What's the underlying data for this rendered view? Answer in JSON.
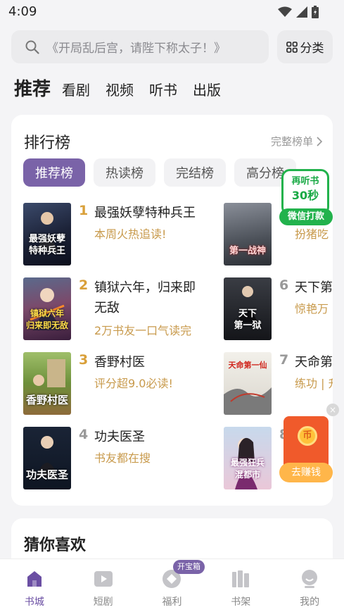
{
  "status": {
    "time": "4:09",
    "icons": [
      "wifi-icon",
      "signal-icon",
      "battery-icon"
    ]
  },
  "search": {
    "placeholder": "《开局乱后宫，请陛下称太子！》",
    "category_label": "分类"
  },
  "top_tabs": [
    {
      "label": "推荐",
      "active": true
    },
    {
      "label": "看剧"
    },
    {
      "label": "视频"
    },
    {
      "label": "听书"
    },
    {
      "label": "出版"
    }
  ],
  "ranking": {
    "title": "排行榜",
    "more_label": "完整榜单",
    "chips": [
      {
        "label": "推荐榜",
        "active": true
      },
      {
        "label": "热读榜"
      },
      {
        "label": "完结榜"
      },
      {
        "label": "高分榜"
      }
    ],
    "left_books": [
      {
        "rank": "1",
        "title": "最强妖孽特种兵王",
        "subtitle": "本周火热追读!",
        "cover_text": "最强妖孽\n特种兵王"
      },
      {
        "rank": "2",
        "title": "镇狱六年，归来即无敌",
        "subtitle": "2万书友一口气读完",
        "cover_text": "镇狱六年\n归来即无敌"
      },
      {
        "rank": "3",
        "title": "香野村医",
        "subtitle": "评分超9.0必读!",
        "cover_text": "香野村医"
      },
      {
        "rank": "4",
        "title": "功夫医圣",
        "subtitle": "书友都在搜",
        "cover_text": "功夫医圣"
      }
    ],
    "right_books": [
      {
        "rank": "",
        "title": "",
        "subtitle": "扮猪吃",
        "cover_text": "第一战神"
      },
      {
        "rank": "6",
        "title": "天下第",
        "subtitle": "惊艳万",
        "cover_text": "天下\n第一狱"
      },
      {
        "rank": "7",
        "title": "天命第",
        "subtitle": "练功 | 升",
        "cover_text": "天命第一仙"
      },
      {
        "rank": "8",
        "title": "",
        "subtitle": "",
        "cover_text": "最强狂兵\n混都市"
      }
    ]
  },
  "audio_promo": {
    "line1": "再听书",
    "line2": "30秒",
    "button": "微信打款"
  },
  "earn_promo": {
    "coin": "币",
    "button": "去赚钱",
    "close": "×"
  },
  "guess": {
    "title": "猜你喜欢"
  },
  "bottom_nav": {
    "items": [
      {
        "label": "书城",
        "icon": "bookstore-icon",
        "active": true
      },
      {
        "label": "短剧",
        "icon": "play-icon"
      },
      {
        "label": "福利",
        "icon": "gift-icon"
      },
      {
        "label": "书架",
        "icon": "bookshelf-icon"
      },
      {
        "label": "我的",
        "icon": "profile-icon"
      }
    ],
    "badge": "开宝箱"
  },
  "colors": {
    "accent": "#7a63a8",
    "gold": "#c89a4c",
    "green": "#22b24c",
    "orange": "#f05a2b"
  }
}
